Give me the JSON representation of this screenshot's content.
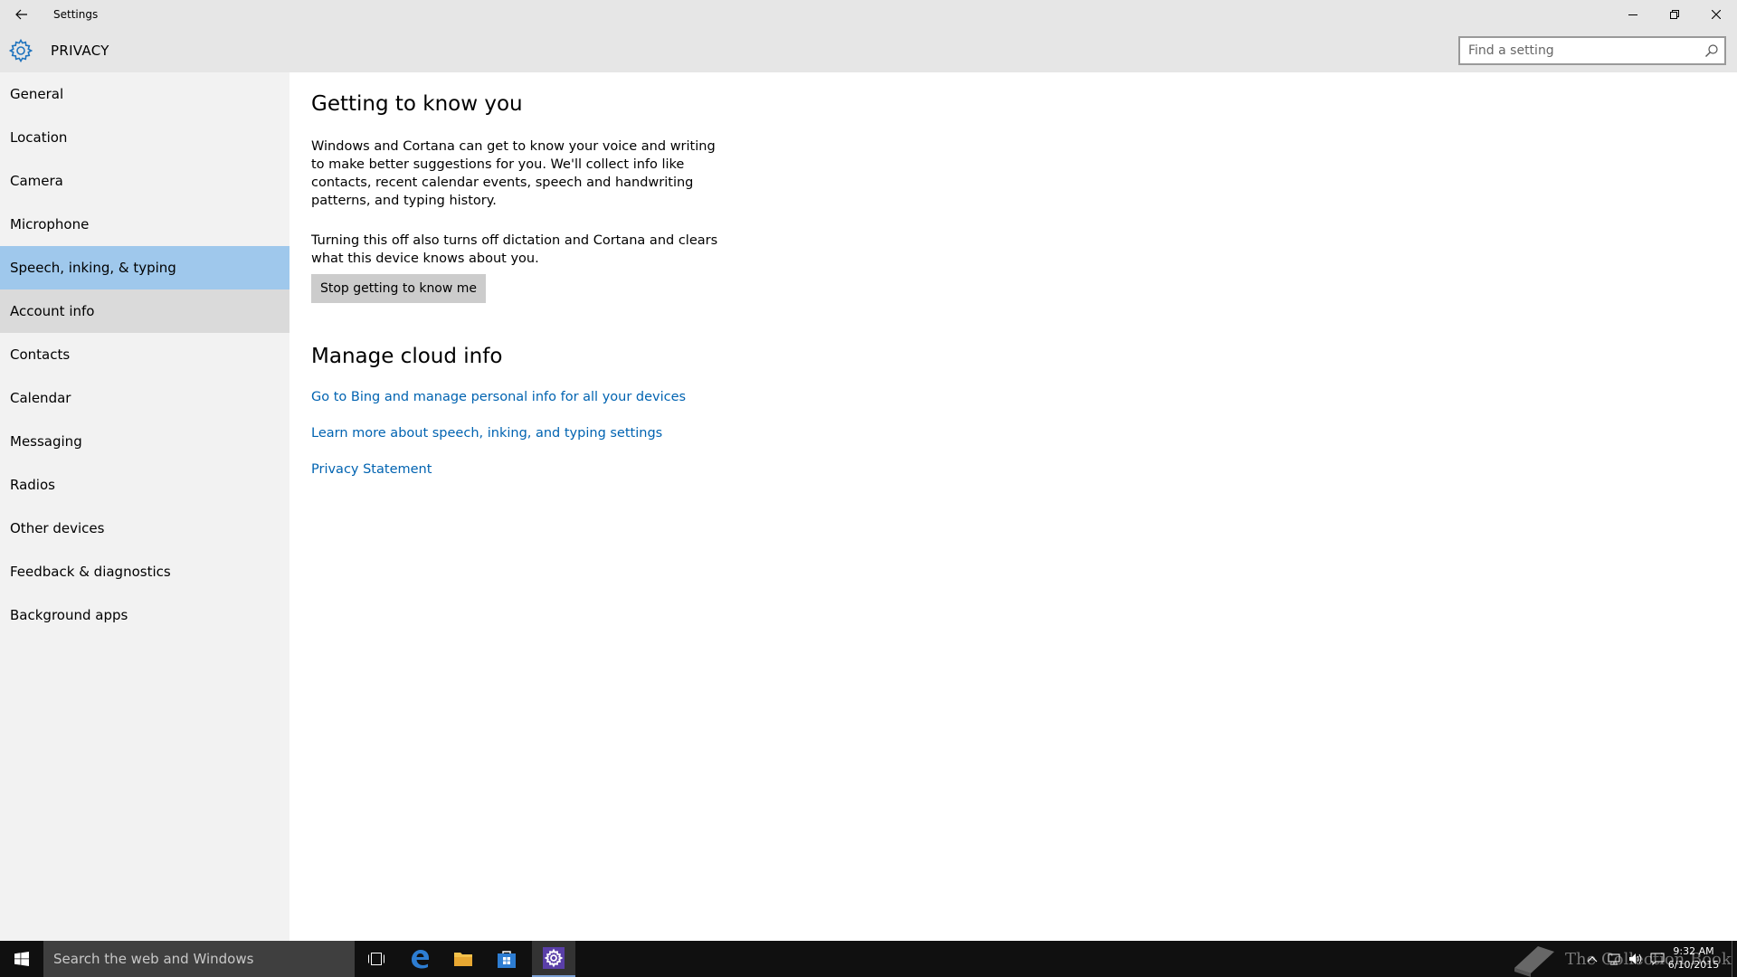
{
  "window": {
    "title": "Settings"
  },
  "header": {
    "title": "PRIVACY",
    "search_placeholder": "Find a setting"
  },
  "sidebar": {
    "items": [
      {
        "label": "General"
      },
      {
        "label": "Location"
      },
      {
        "label": "Camera"
      },
      {
        "label": "Microphone"
      },
      {
        "label": "Speech, inking, & typing"
      },
      {
        "label": "Account info"
      },
      {
        "label": "Contacts"
      },
      {
        "label": "Calendar"
      },
      {
        "label": "Messaging"
      },
      {
        "label": "Radios"
      },
      {
        "label": "Other devices"
      },
      {
        "label": "Feedback & diagnostics"
      },
      {
        "label": "Background apps"
      }
    ],
    "selected": "Speech, inking, & typing",
    "hovered": "Account info"
  },
  "main": {
    "section1_title": "Getting to know you",
    "section1_desc1": "Windows and Cortana can get to know your voice and writing to make better suggestions for you. We'll collect info like contacts, recent calendar events, speech and handwriting patterns, and typing history.",
    "section1_desc2": "Turning this off also turns off dictation and Cortana and clears what this device knows about you.",
    "stop_button_label": "Stop getting to know me",
    "section2_title": "Manage cloud info",
    "link1": "Go to Bing and manage personal info for all your devices",
    "link2": "Learn more about speech, inking, and typing settings",
    "link3": "Privacy Statement"
  },
  "taskbar": {
    "search_placeholder": "Search the web and Windows",
    "watermark": "The Collection Book",
    "time": "9:32 AM",
    "date": "6/10/2015"
  },
  "colors": {
    "accent": "#0063b1",
    "selected_nav": "#9fc8ec",
    "gear_icon": "#1e73be"
  }
}
